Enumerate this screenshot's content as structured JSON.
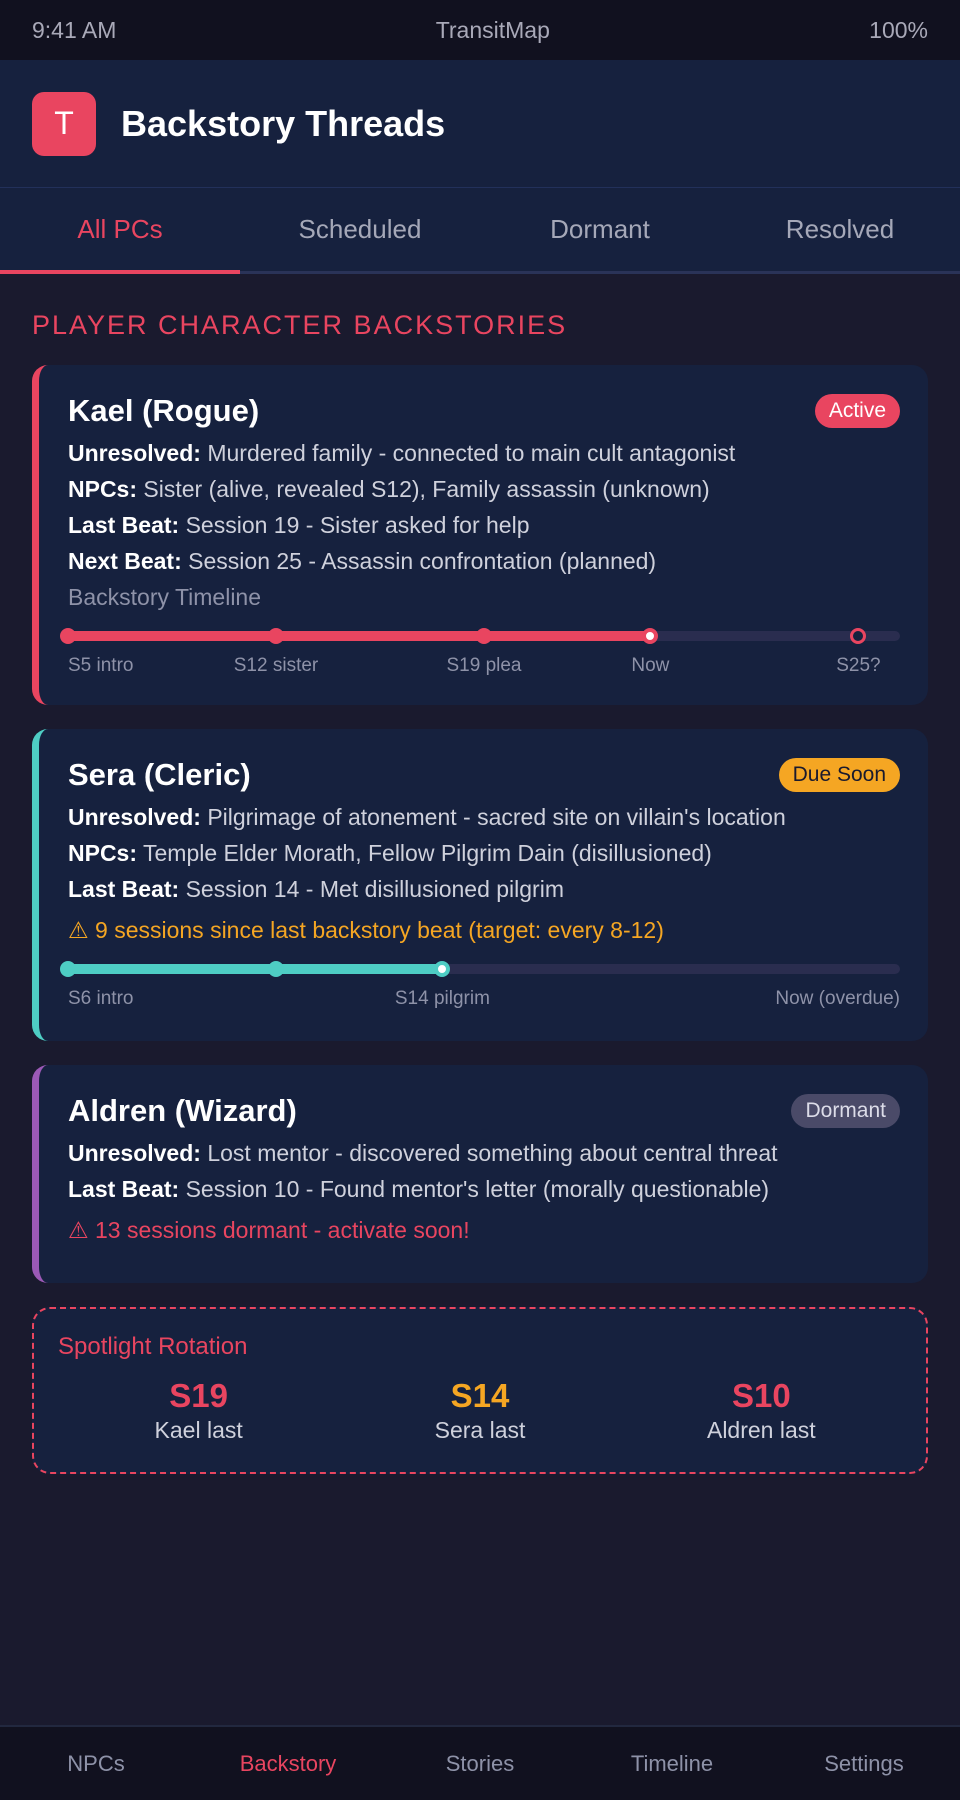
{
  "status_bar": {
    "time": "9:41 AM",
    "app": "TransitMap",
    "battery": "100%"
  },
  "header": {
    "logo_letter": "T",
    "title": "Backstory Threads"
  },
  "tabs": [
    {
      "label": "All PCs",
      "active": true
    },
    {
      "label": "Scheduled",
      "active": false
    },
    {
      "label": "Dormant",
      "active": false
    },
    {
      "label": "Resolved",
      "active": false
    }
  ],
  "section_title": "PLAYER CHARACTER BACKSTORIES",
  "characters": [
    {
      "name": "Kael (Rogue)",
      "status": "Active",
      "accent": "#e94560",
      "unresolved_label": "Unresolved:",
      "unresolved": "Murdered family - connected to main cult antagonist",
      "npcs_label": "NPCs:",
      "npcs": "Sister (alive, revealed S12), Family assassin (unknown)",
      "last_beat_label": "Last Beat:",
      "last_beat": "Session 19 - Sister asked for help",
      "next_beat_label": "Next Beat:",
      "next_beat": "Session 25 - Assassin confrontation (planned)",
      "timeline_label": "Backstory Timeline",
      "timeline": {
        "progress": 0.7,
        "points": [
          {
            "label": "S5 intro",
            "pos": 0.0,
            "kind": "done"
          },
          {
            "label": "S12 sister",
            "pos": 0.25,
            "kind": "done"
          },
          {
            "label": "S19 plea",
            "pos": 0.5,
            "kind": "done"
          },
          {
            "label": "Now",
            "pos": 0.7,
            "kind": "now"
          },
          {
            "label": "S25?",
            "pos": 0.95,
            "kind": "future"
          }
        ]
      }
    },
    {
      "name": "Sera (Cleric)",
      "status": "Due Soon",
      "accent": "#4ecdc4",
      "unresolved_label": "Unresolved:",
      "unresolved": "Pilgrimage of atonement - sacred site on villain's location",
      "npcs_label": "NPCs:",
      "npcs": "Temple Elder Morath, Fellow Pilgrim Dain (disillusioned)",
      "last_beat_label": "Last Beat:",
      "last_beat": "Session 14 - Met disillusioned pilgrim",
      "warning": "⚠ 9 sessions since last backstory beat (target: every 8-12)",
      "timeline": {
        "progress": 0.45,
        "points": [
          {
            "label": "S6 intro",
            "pos": 0.0,
            "kind": "done"
          },
          {
            "label": "",
            "pos": 0.25,
            "kind": "done"
          },
          {
            "label": "S14 pilgrim",
            "pos": 0.45,
            "kind": "now"
          },
          {
            "label": "Now (overdue)",
            "pos": 1.0,
            "kind": "label-only"
          }
        ]
      }
    },
    {
      "name": "Aldren (Wizard)",
      "status": "Dormant",
      "accent": "#9b59b6",
      "unresolved_label": "Unresolved:",
      "unresolved": "Lost mentor - discovered something about central threat",
      "last_beat_label": "Last Beat:",
      "last_beat": "Session 10 - Found mentor's letter (morally questionable)",
      "warning": "⚠ 13 sessions dormant - activate soon!"
    }
  ],
  "spotlight": {
    "title": "Spotlight Rotation",
    "items": [
      {
        "value": "S19",
        "label": "Kael last",
        "color": "#e94560"
      },
      {
        "value": "S14",
        "label": "Sera last",
        "color": "#f5a623"
      },
      {
        "value": "S10",
        "label": "Aldren last",
        "color": "#e94560"
      }
    ]
  },
  "bottom_nav": [
    {
      "label": "NPCs",
      "active": false
    },
    {
      "label": "Backstory",
      "active": true
    },
    {
      "label": "Stories",
      "active": false
    },
    {
      "label": "Timeline",
      "active": false
    },
    {
      "label": "Settings",
      "active": false
    }
  ]
}
